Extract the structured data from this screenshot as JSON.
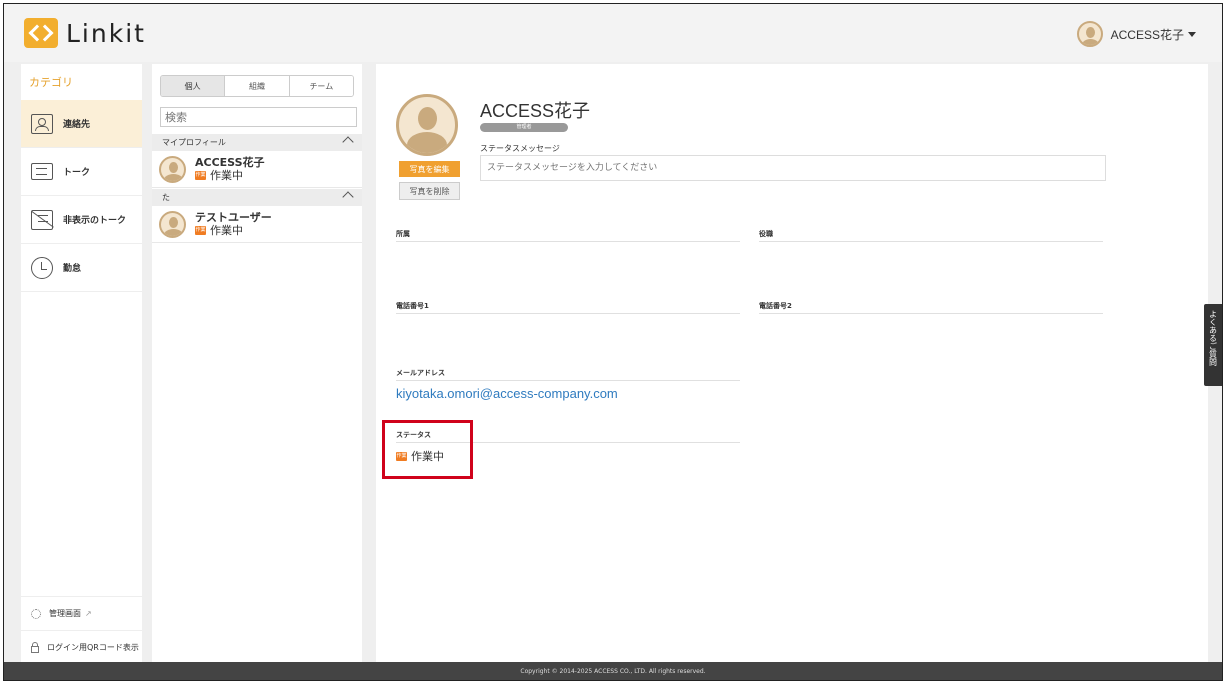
{
  "app": {
    "logo_text": "Linkit",
    "accent": "#f2ae2e"
  },
  "header": {
    "user_name": "ACCESS花子"
  },
  "sidebar": {
    "category_title": "カテゴリ",
    "items": [
      {
        "label": "連絡先",
        "icon": "contact-book-icon",
        "active": true
      },
      {
        "label": "トーク",
        "icon": "chat-icon"
      },
      {
        "label": "非表示のトーク",
        "icon": "hidden-chat-icon"
      },
      {
        "label": "勤怠",
        "icon": "clock-icon"
      }
    ],
    "admin_label": "管理画面",
    "qr_label": "ログイン用QRコード表示"
  },
  "contacts": {
    "tabs": [
      "個人",
      "組織",
      "チーム"
    ],
    "search_placeholder": "検索",
    "groups": [
      {
        "header": "マイプロフィール",
        "members": [
          {
            "name": "ACCESS花子",
            "badge": "作業",
            "status": "作業中"
          }
        ]
      },
      {
        "header": "た",
        "members": [
          {
            "name": "テストユーザー",
            "badge": "作業",
            "status": "作業中"
          }
        ]
      }
    ]
  },
  "profile": {
    "name": "ACCESS花子",
    "role": "管理者",
    "edit_photo_label": "写真を編集",
    "delete_photo_label": "写真を削除",
    "status_message_label": "ステータスメッセージ",
    "status_message_placeholder": "ステータスメッセージを入力してください",
    "fields": {
      "affiliation_label": "所属",
      "position_label": "役職",
      "phone1_label": "電話番号1",
      "phone2_label": "電話番号2",
      "email_label": "メールアドレス",
      "email_value": "kiyotaka.omori@access-company.com",
      "status_label": "ステータス",
      "status_badge": "作業",
      "status_value": "作業中"
    }
  },
  "faq_label": "よくあるご質問",
  "footer": {
    "copyright": "Copyright © 2014-2025 ACCESS CO., LTD. All rights reserved."
  }
}
